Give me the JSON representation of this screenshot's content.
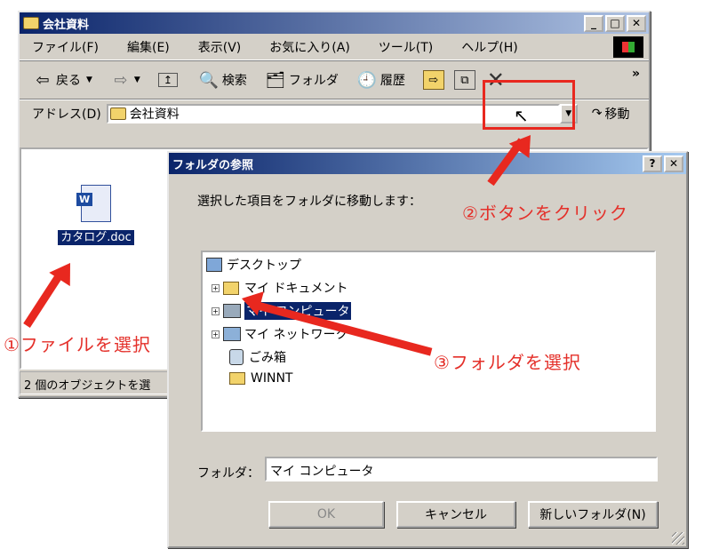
{
  "explorer": {
    "title": "会社資料",
    "menu": [
      "ファイル(F)",
      "編集(E)",
      "表示(V)",
      "お気に入り(A)",
      "ツール(T)",
      "ヘルプ(H)"
    ],
    "toolbar": {
      "back": "戻る",
      "search": "検索",
      "folders": "フォルダ",
      "history": "履歴",
      "more": "»"
    },
    "address_label": "アドレス(D)",
    "address_value": "会社資料",
    "go_label": "移動",
    "file_name": "カタログ.doc",
    "status_text": "2 個のオブジェクトを選"
  },
  "dialog": {
    "title": "フォルダの参照",
    "instruction": "選択した項目をフォルダに移動します：",
    "tree": [
      "デスクトップ",
      "マイ ドキュメント",
      "マイ コンピュータ",
      "マイ ネットワーク",
      "ごみ箱",
      "WINNT"
    ],
    "folder_label": "フォルダ：",
    "folder_value": "マイ コンピュータ",
    "ok_label": "OK",
    "cancel_label": "キャンセル",
    "new_folder_label": "新しいフォルダ(N)"
  },
  "annotations": {
    "step1": "①ファイルを選択",
    "step2": "②ボタンをクリック",
    "step3": "③フォルダを選択",
    "color": "#e4302a"
  }
}
